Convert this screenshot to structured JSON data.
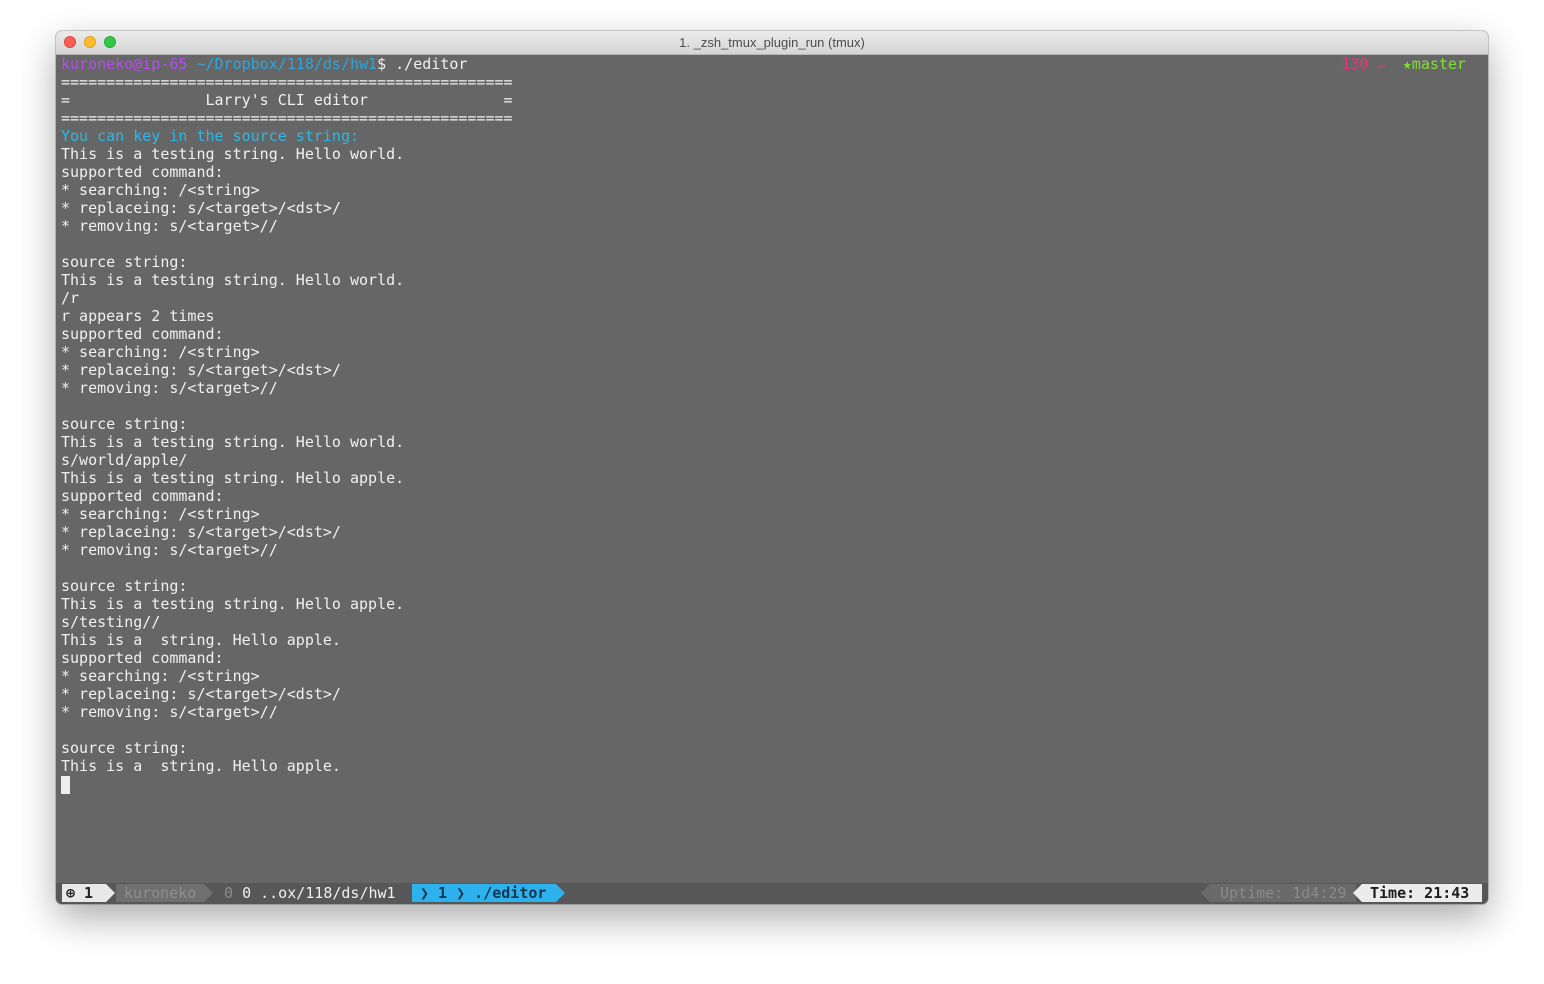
{
  "window": {
    "title": "1. _zsh_tmux_plugin_run (tmux)"
  },
  "prompt": {
    "user_host": "kuroneko@ip-65",
    "path": "~/Dropbox/118/ds/hw1",
    "symbol": "$",
    "command": "./editor",
    "exit_code": "130",
    "return_icon": "↵",
    "git_branch": "★master"
  },
  "terminal_lines": [
    "==================================================",
    "=               Larry's CLI editor               =",
    "==================================================",
    "You can key in the source string:",
    "This is a testing string. Hello world.",
    "supported command:",
    "* searching: /<string>",
    "* replaceing: s/<target>/<dst>/",
    "* removing: s/<target>//",
    "",
    "source string:",
    "This is a testing string. Hello world.",
    "/r",
    "r appears 2 times",
    "supported command:",
    "* searching: /<string>",
    "* replaceing: s/<target>/<dst>/",
    "* removing: s/<target>//",
    "",
    "source string:",
    "This is a testing string. Hello world.",
    "s/world/apple/",
    "This is a testing string. Hello apple.",
    "supported command:",
    "* searching: /<string>",
    "* replaceing: s/<target>/<dst>/",
    "* removing: s/<target>//",
    "",
    "source string:",
    "This is a testing string. Hello apple.",
    "s/testing//",
    "This is a  string. Hello apple.",
    "supported command:",
    "* searching: /<string>",
    "* replaceing: s/<target>/<dst>/",
    "* removing: s/<target>//",
    "",
    "source string:",
    "This is a  string. Hello apple."
  ],
  "status_bar": {
    "session": "⊕ 1",
    "user": "kuroneko",
    "window0_index": "0",
    "window0_label": "0 ..ox/118/ds/hw1",
    "window1_label": "❯ 1 ❯ ./editor",
    "uptime": "Uptime: 1d4:29",
    "time": "Time: 21:43"
  },
  "colors": {
    "terminal_bg": "#666666",
    "prompt_user": "#b64cf0",
    "prompt_path": "#2aa6e0",
    "highlight_cyan": "#2bb8e6",
    "git_branch": "#7ce22e",
    "exit_code": "#e8347a",
    "active_window": "#2db2ed"
  }
}
